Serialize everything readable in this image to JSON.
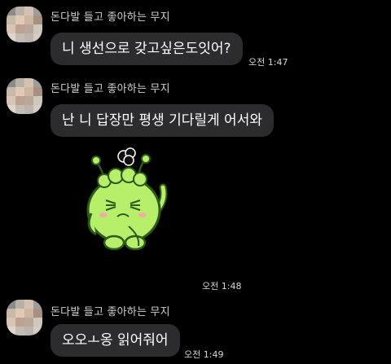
{
  "messages": [
    {
      "sender": "돈다발 들고 좋아하는 무지",
      "text": "니 생선으로 갖고싶은도잇어?",
      "time": "오전 1:47"
    },
    {
      "sender": "돈다발 들고 좋아하는 무지",
      "text": "난 니 답장만 평생 기다릴게 어서와",
      "time": "오전 1:48",
      "sticker": "green-character-sticker"
    },
    {
      "sender": "돈다발 들고 좋아하는 무지",
      "text": "오오ㅗ옹 읽어줘어",
      "time": "오전 1:49"
    }
  ],
  "colors": {
    "background": "#000000",
    "bubble": "#2c2c2e",
    "sticker_body": "#b8ef6a",
    "sticker_outline": "#2b5a1a"
  }
}
